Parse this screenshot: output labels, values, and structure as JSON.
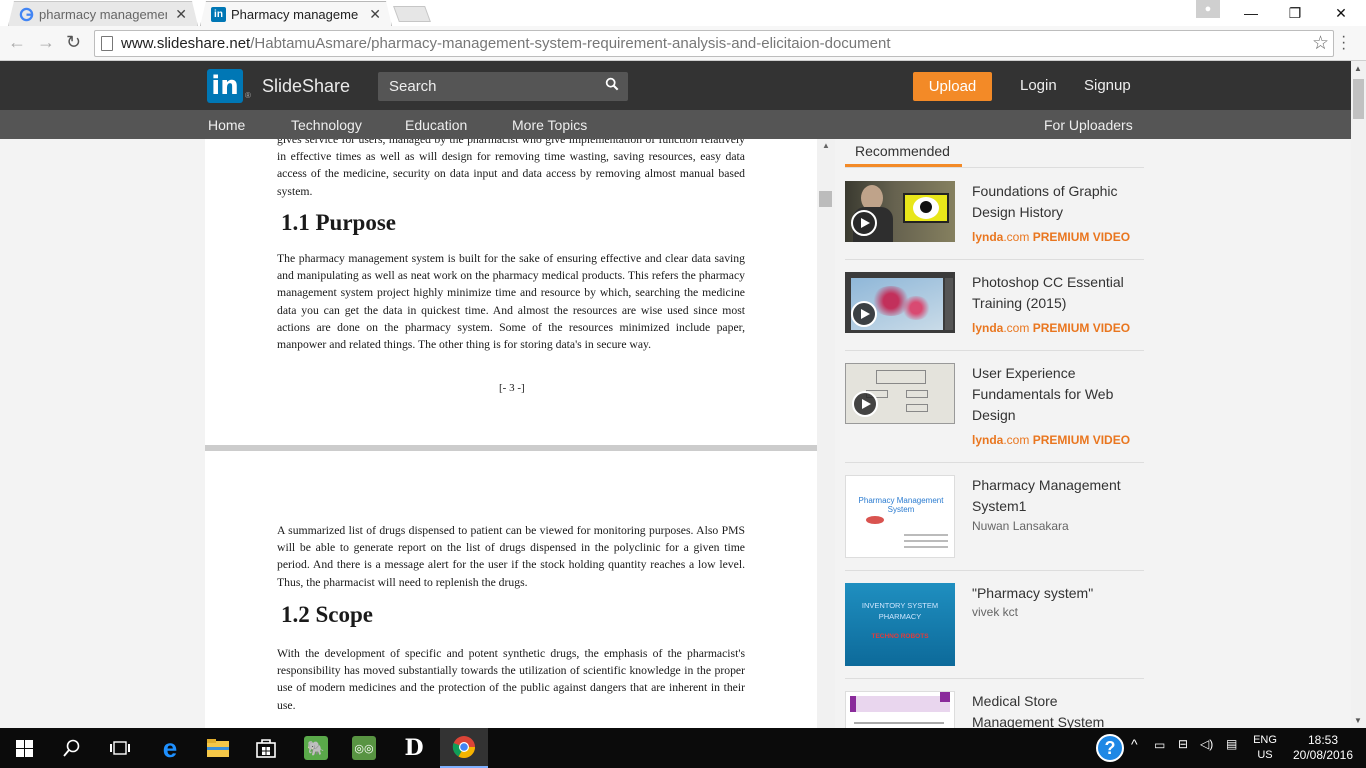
{
  "browser": {
    "tabs": [
      {
        "title": "pharmacy management sy",
        "close": "✕"
      },
      {
        "title": "Pharmacy management sy",
        "close": "✕"
      }
    ],
    "url_domain": "www.slideshare.net",
    "url_path": "/HabtamuAsmare/pharmacy-management-system-requirement-analysis-and-elicitaion-document"
  },
  "header": {
    "logo_in": "in",
    "logo_text": "SlideShare",
    "search_placeholder": "Search",
    "upload": "Upload",
    "login": "Login",
    "signup": "Signup"
  },
  "nav": {
    "home": "Home",
    "technology": "Technology",
    "education": "Education",
    "more_topics": "More Topics",
    "for_uploaders": "For Uploaders"
  },
  "doc": {
    "para_top": "gives service for users, managed by the pharmacist who give implementation of function relatively in effective times as well as will design for removing time wasting, saving resources, easy data access of the medicine, security on data input and data access by removing almost manual based system.",
    "h_purpose": "1.1 Purpose",
    "para_purpose": "The pharmacy management system is built for the sake of ensuring effective and clear data saving and manipulating as well as neat work on the pharmacy medical products. This refers the pharmacy management system project highly minimize time and resource by which, searching the medicine data you can get the data in quickest time. And almost the resources are wise used since most actions are done on the pharmacy system. Some of the resources minimized include paper, manpower and related things. The other thing is for storing data's in secure way.",
    "page_number": "[- 3 -]",
    "para_summary": "A summarized list of drugs dispensed to patient can be viewed for monitoring purposes. Also PMS will be able to generate report on the list of drugs dispensed in the polyclinic for a given time period. And there is a message alert for the user if the stock holding quantity reaches a low level. Thus, the pharmacist will need to replenish the drugs.",
    "h_scope": "1.2 Scope",
    "para_scope": "With the development of specific and potent synthetic drugs, the emphasis of the pharmacist's responsibility has moved substantially towards the utilization of scientific knowledge in the proper use of modern medicines and the protection of the public against dangers that are inherent in their use."
  },
  "sidebar": {
    "tab": "Recommended",
    "premium_lynda": "lynda",
    "premium_com": ".com",
    "premium_label": "PREMIUM VIDEO",
    "items": [
      {
        "title": "Foundations of Graphic Design History"
      },
      {
        "title": "Photoshop CC Essential Training (2015)"
      },
      {
        "title": "User Experience Fundamentals for Web Design"
      },
      {
        "title": "Pharmacy Management System1",
        "author": "Nuwan Lansakara",
        "thumb_text": "Pharmacy Management System"
      },
      {
        "title": "\"Pharmacy system\"",
        "author": "vivek kct",
        "thumb_text1": "INVENTORY SYSTEM",
        "thumb_text2": "PHARMACY",
        "thumb_text3": "TECHNO ROBOTS"
      },
      {
        "title": "Medical Store Management System Software"
      }
    ]
  },
  "taskbar": {
    "lang1": "ENG",
    "lang2": "US",
    "time": "18:53",
    "date": "20/08/2016"
  }
}
